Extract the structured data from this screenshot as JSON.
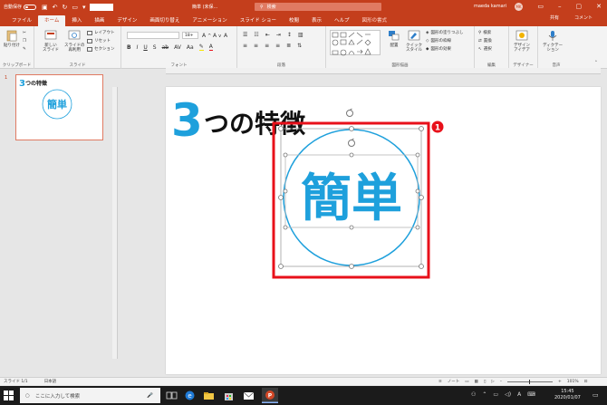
{
  "titlebar": {
    "autosave_label": "自動保存",
    "autosave_state": "オフ",
    "doc_title": "簡単 (未保...",
    "search_placeholder": "検索",
    "user_name": "maeda kamari",
    "user_initials": "MK"
  },
  "tabs": [
    {
      "label": "ファイル"
    },
    {
      "label": "ホーム"
    },
    {
      "label": "挿入"
    },
    {
      "label": "描画"
    },
    {
      "label": "デザイン"
    },
    {
      "label": "画面切り替え"
    },
    {
      "label": "アニメーション"
    },
    {
      "label": "スライド ショー"
    },
    {
      "label": "校閲"
    },
    {
      "label": "表示"
    },
    {
      "label": "ヘルプ"
    },
    {
      "label": "図形の書式"
    }
  ],
  "share_label": "共有",
  "comment_label": "コメント",
  "ribbon": {
    "paste": "貼り付け",
    "clipboard": "クリップボード",
    "new_slide": "新しい\nスライド",
    "reuse_slide": "スライドの\n再利用",
    "layout": "レイアウト",
    "reset": "リセット",
    "section": "セクション",
    "slides_group": "スライド",
    "font_size": "18+",
    "font_group": "フォント",
    "paragraph_group": "段落",
    "drawing_group": "図形描画",
    "arrange": "配置",
    "quick_styles": "クイック\nスタイル",
    "shape_fill": "図形の塗りつぶし",
    "shape_outline": "図形の枠線",
    "shape_effects": "図形の効果",
    "find": "検索",
    "replace": "置換",
    "select": "選択",
    "editing_group": "編集",
    "designer": "デザイン\nアイデア",
    "designer_group": "デザイナー",
    "dictate": "ディクテー\nション",
    "voice_group": "音声"
  },
  "thumbnail": {
    "number": "1",
    "title_num": "3",
    "title_rest": "つの特徴",
    "circle_text": "簡単"
  },
  "slide": {
    "title_num": "3",
    "title_rest": "つの特徴",
    "circle_text": "簡単",
    "callout_number": "1"
  },
  "statusbar": {
    "slide_info": "スライド 1/1",
    "language": "日本語",
    "notes": "ノート",
    "zoom": "101%"
  },
  "taskbar": {
    "search_placeholder": "ここに入力して検索",
    "time": "15:45",
    "date": "2020/01/07"
  },
  "colors": {
    "accent": "#c43e1c",
    "blue_title": "#1ea0dc",
    "circle": "#1ea0dc",
    "callout": "#e8101a"
  }
}
